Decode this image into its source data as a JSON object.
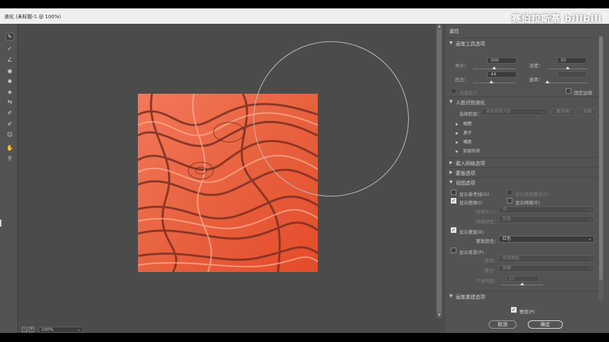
{
  "window": {
    "title": "液化 (未标题-1 @ 100%)"
  },
  "watermark": "赛伯拉斯基 bilibili",
  "tools": [
    {
      "icon": "forward-warp-icon",
      "glyph": "✎"
    },
    {
      "icon": "reconstruct-icon",
      "glyph": "✓"
    },
    {
      "icon": "smooth-icon",
      "glyph": "∠"
    },
    {
      "icon": "twirl-icon",
      "glyph": "◉"
    },
    {
      "icon": "pucker-icon",
      "glyph": "✺"
    },
    {
      "icon": "bloat-icon",
      "glyph": "◈"
    },
    {
      "icon": "push-left-icon",
      "glyph": "⇆"
    },
    {
      "icon": "freeze-mask-icon",
      "glyph": "✐"
    },
    {
      "icon": "thaw-mask-icon",
      "glyph": "✐"
    },
    {
      "icon": "face-tool-icon",
      "glyph": "☺"
    },
    {
      "icon": "hand-icon",
      "glyph": "✋"
    },
    {
      "icon": "zoom-icon",
      "glyph": "⚲"
    }
  ],
  "status": {
    "zoom": "100%"
  },
  "panel": {
    "title": "属性",
    "brush_tool_options": {
      "heading": "画笔工具选项",
      "size_label": "大小：",
      "size_value": "500",
      "density_label": "浓度：",
      "density_value": "50",
      "pressure_label": "压力：",
      "pressure_value": "44",
      "rate_label": "速率：",
      "rate_value": "",
      "stylus_label": "光笔压力",
      "pin_edges_label": "固定边缘",
      "size_level": 0.5,
      "density_level": 0.5,
      "pressure_level": 0.44,
      "rate_level": 0.0
    },
    "face_aware": {
      "heading": "人脸识别液化",
      "select_face_label": "选择脸部：",
      "select_face_value": "未检测到人脸",
      "reset_label": "复位(R)",
      "all_label": "全部",
      "subs": [
        "眼睛",
        "鼻子",
        "嘴唇",
        "脸部形状"
      ]
    },
    "load_mesh": {
      "heading": "载入网格选项"
    },
    "mask": {
      "heading": "蒙版选项"
    },
    "view": {
      "heading": "视图选项",
      "show_guides": "显示参考线(G)",
      "show_face_overlay": "显示面部叠加(F)",
      "show_image": "显示图像(I)",
      "show_mesh": "显示网格(E)",
      "mesh_size_label": "网格大小：",
      "mesh_size_value": "中",
      "mesh_color_label": "网格颜色：",
      "mesh_color_value": "灰色",
      "show_mask": "显示蒙版(K)",
      "mask_color_label": "蒙版颜色：",
      "mask_color_value": "红色",
      "show_backdrop": "显示背景(P)",
      "use_label": "使用：",
      "use_value": "所有图层",
      "mode_label": "模式：",
      "mode_value": "前面",
      "opacity_label": "不透明度：",
      "opacity_value": "50",
      "opacity_level": 0.5
    },
    "brush_reconstruct": {
      "heading": "画笔重建选项"
    },
    "preview_label": "预览(P)",
    "cancel_label": "取消",
    "ok_label": "确定"
  }
}
